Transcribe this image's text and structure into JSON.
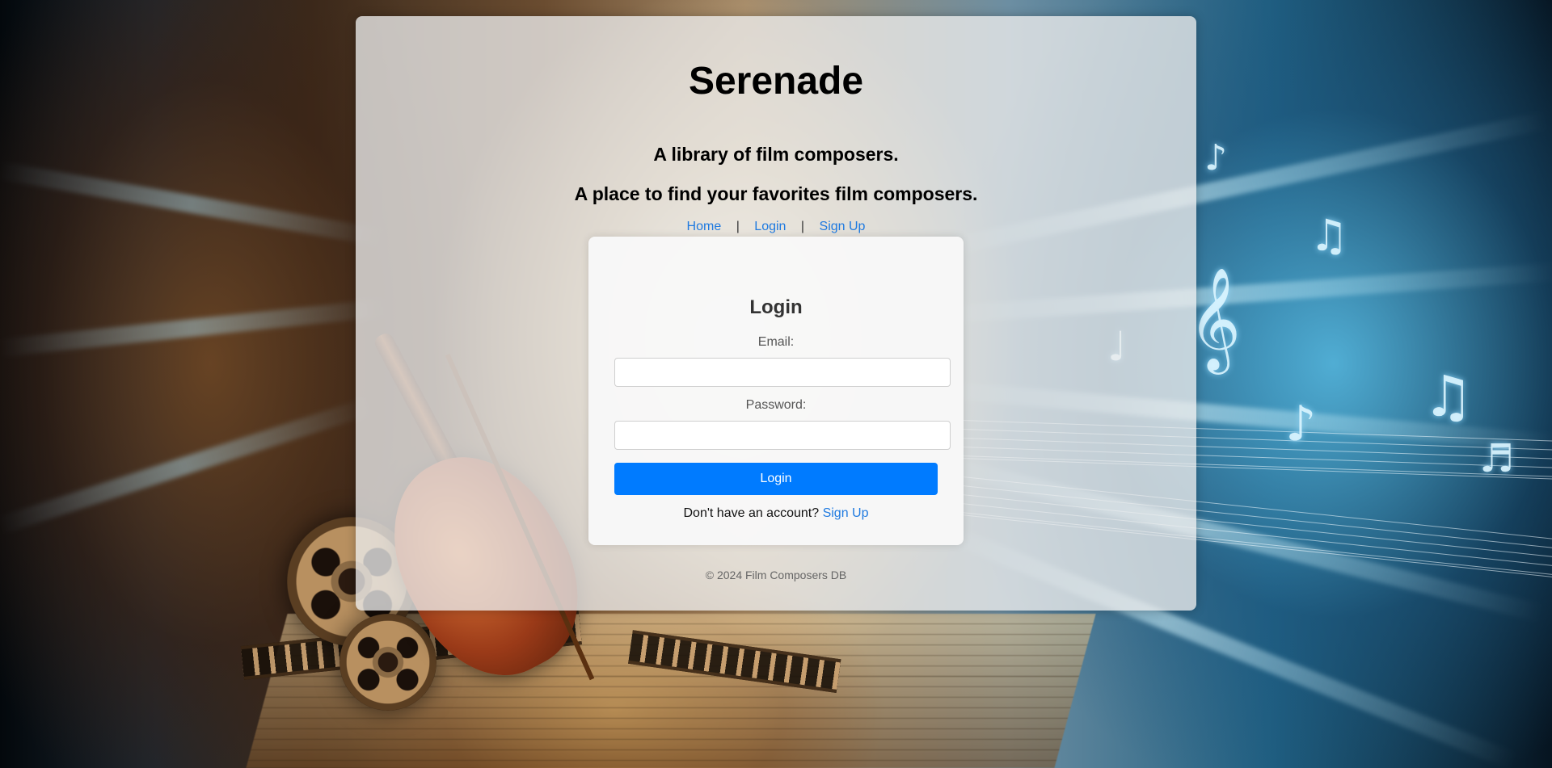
{
  "site": {
    "title": "Serenade",
    "tagline_1": "A library of film composers.",
    "tagline_2": "A place to find your favorites film composers."
  },
  "nav": {
    "home": "Home",
    "login": "Login",
    "signup": "Sign Up",
    "separator": "|"
  },
  "login_form": {
    "title": "Login",
    "email_label": "Email:",
    "email_value": "",
    "password_label": "Password:",
    "password_value": "",
    "submit_label": "Login",
    "no_account_text": "Don't have an account?",
    "signup_link": "Sign Up"
  },
  "footer": {
    "text": "© 2024 Film Composers DB"
  },
  "colors": {
    "accent": "#007bff",
    "link": "#1f7ae0",
    "panel": "#ececec"
  }
}
